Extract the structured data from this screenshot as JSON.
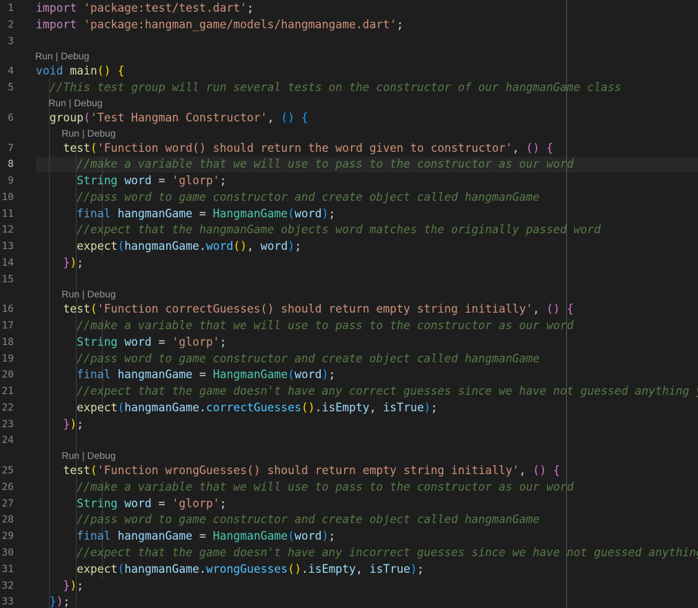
{
  "code_lens": {
    "run": "Run",
    "separator": " | ",
    "debug": "Debug"
  },
  "lines": [
    {
      "n": "1",
      "tokens": [
        [
          "import",
          "ctl"
        ],
        [
          " ",
          "pl"
        ],
        [
          "'package:test/test.dart'",
          "str"
        ],
        [
          ";",
          "pl"
        ]
      ]
    },
    {
      "n": "2",
      "tokens": [
        [
          "import",
          "ctl"
        ],
        [
          " ",
          "pl"
        ],
        [
          "'package:hangman_game/models/hangmangame.dart'",
          "str"
        ],
        [
          ";",
          "pl"
        ]
      ]
    },
    {
      "n": "3",
      "tokens": []
    },
    {
      "n": "4",
      "lens": true,
      "tokens": [
        [
          "void",
          "kw"
        ],
        [
          " ",
          "pl"
        ],
        [
          "main",
          "fn"
        ],
        [
          "()",
          "b1"
        ],
        [
          " ",
          "pl"
        ],
        [
          "{",
          "b1"
        ]
      ]
    },
    {
      "n": "5",
      "tokens": [
        [
          "  ",
          "pl"
        ],
        [
          "//This test group will run several tests on the constructor of our hangmanGame class",
          "cm"
        ]
      ]
    },
    {
      "n": "6",
      "lens": true,
      "tokens": [
        [
          "  ",
          "pl"
        ],
        [
          "group",
          "fn"
        ],
        [
          "(",
          "b2"
        ],
        [
          "'Test Hangman Constructor'",
          "str"
        ],
        [
          ", ",
          "pl"
        ],
        [
          "()",
          "b3"
        ],
        [
          " ",
          "pl"
        ],
        [
          "{",
          "b3"
        ]
      ]
    },
    {
      "n": "7",
      "lens": true,
      "tokens": [
        [
          "    ",
          "pl"
        ],
        [
          "test",
          "fn"
        ],
        [
          "(",
          "b1"
        ],
        [
          "'Function word() should return the word given to constructor'",
          "str"
        ],
        [
          ", ",
          "pl"
        ],
        [
          "()",
          "b2"
        ],
        [
          " ",
          "pl"
        ],
        [
          "{",
          "b2"
        ]
      ]
    },
    {
      "n": "8",
      "active": true,
      "tokens": [
        [
          "      ",
          "pl"
        ],
        [
          "//make a variable that we will use to pass to the constructor as our word",
          "cm"
        ]
      ]
    },
    {
      "n": "9",
      "tokens": [
        [
          "      ",
          "pl"
        ],
        [
          "String",
          "ty"
        ],
        [
          " ",
          "pl"
        ],
        [
          "word",
          "var"
        ],
        [
          " = ",
          "pl"
        ],
        [
          "'glorp'",
          "str"
        ],
        [
          ";",
          "pl"
        ]
      ]
    },
    {
      "n": "10",
      "tokens": [
        [
          "      ",
          "pl"
        ],
        [
          "//pass word to game constructor and create object called hangmanGame",
          "cm"
        ]
      ]
    },
    {
      "n": "11",
      "tokens": [
        [
          "      ",
          "pl"
        ],
        [
          "final",
          "kw"
        ],
        [
          " ",
          "pl"
        ],
        [
          "hangmanGame",
          "var"
        ],
        [
          " = ",
          "pl"
        ],
        [
          "HangmanGame",
          "ty"
        ],
        [
          "(",
          "b3"
        ],
        [
          "word",
          "var"
        ],
        [
          ")",
          "b3"
        ],
        [
          ";",
          "pl"
        ]
      ]
    },
    {
      "n": "12",
      "tokens": [
        [
          "      ",
          "pl"
        ],
        [
          "//expect that the hangmanGame objects word matches the originally passed word",
          "cm"
        ]
      ]
    },
    {
      "n": "13",
      "tokens": [
        [
          "      ",
          "pl"
        ],
        [
          "expect",
          "fn"
        ],
        [
          "(",
          "b3"
        ],
        [
          "hangmanGame",
          "var"
        ],
        [
          ".",
          "pl"
        ],
        [
          "word",
          "meth"
        ],
        [
          "()",
          "b1"
        ],
        [
          ", ",
          "pl"
        ],
        [
          "word",
          "var"
        ],
        [
          ")",
          "b3"
        ],
        [
          ";",
          "pl"
        ]
      ]
    },
    {
      "n": "14",
      "tokens": [
        [
          "    ",
          "pl"
        ],
        [
          "}",
          "b2"
        ],
        [
          ")",
          "b1"
        ],
        [
          ";",
          "pl"
        ]
      ]
    },
    {
      "n": "15",
      "tokens": []
    },
    {
      "n": "16",
      "lens": true,
      "tokens": [
        [
          "    ",
          "pl"
        ],
        [
          "test",
          "fn"
        ],
        [
          "(",
          "b1"
        ],
        [
          "'Function correctGuesses() should return empty string initially'",
          "str"
        ],
        [
          ", ",
          "pl"
        ],
        [
          "()",
          "b2"
        ],
        [
          " ",
          "pl"
        ],
        [
          "{",
          "b2"
        ]
      ]
    },
    {
      "n": "17",
      "tokens": [
        [
          "      ",
          "pl"
        ],
        [
          "//make a variable that we will use to pass to the constructor as our word",
          "cm"
        ]
      ]
    },
    {
      "n": "18",
      "tokens": [
        [
          "      ",
          "pl"
        ],
        [
          "String",
          "ty"
        ],
        [
          " ",
          "pl"
        ],
        [
          "word",
          "var"
        ],
        [
          " = ",
          "pl"
        ],
        [
          "'glorp'",
          "str"
        ],
        [
          ";",
          "pl"
        ]
      ]
    },
    {
      "n": "19",
      "tokens": [
        [
          "      ",
          "pl"
        ],
        [
          "//pass word to game constructor and create object called hangmanGame",
          "cm"
        ]
      ]
    },
    {
      "n": "20",
      "tokens": [
        [
          "      ",
          "pl"
        ],
        [
          "final",
          "kw"
        ],
        [
          " ",
          "pl"
        ],
        [
          "hangmanGame",
          "var"
        ],
        [
          " = ",
          "pl"
        ],
        [
          "HangmanGame",
          "ty"
        ],
        [
          "(",
          "b3"
        ],
        [
          "word",
          "var"
        ],
        [
          ")",
          "b3"
        ],
        [
          ";",
          "pl"
        ]
      ]
    },
    {
      "n": "21",
      "tokens": [
        [
          "      ",
          "pl"
        ],
        [
          "//expect that the game doesn't have any correct guesses since we have not guessed anything yet",
          "cm"
        ]
      ]
    },
    {
      "n": "22",
      "tokens": [
        [
          "      ",
          "pl"
        ],
        [
          "expect",
          "fn"
        ],
        [
          "(",
          "b3"
        ],
        [
          "hangmanGame",
          "var"
        ],
        [
          ".",
          "pl"
        ],
        [
          "correctGuesses",
          "meth"
        ],
        [
          "()",
          "b1"
        ],
        [
          ".",
          "pl"
        ],
        [
          "isEmpty",
          "var"
        ],
        [
          ", ",
          "pl"
        ],
        [
          "isTrue",
          "var"
        ],
        [
          ")",
          "b3"
        ],
        [
          ";",
          "pl"
        ]
      ]
    },
    {
      "n": "23",
      "tokens": [
        [
          "    ",
          "pl"
        ],
        [
          "}",
          "b2"
        ],
        [
          ")",
          "b1"
        ],
        [
          ";",
          "pl"
        ]
      ]
    },
    {
      "n": "24",
      "tokens": []
    },
    {
      "n": "25",
      "lens": true,
      "tokens": [
        [
          "    ",
          "pl"
        ],
        [
          "test",
          "fn"
        ],
        [
          "(",
          "b1"
        ],
        [
          "'Function wrongGuesses() should return empty string initially'",
          "str"
        ],
        [
          ", ",
          "pl"
        ],
        [
          "()",
          "b2"
        ],
        [
          " ",
          "pl"
        ],
        [
          "{",
          "b2"
        ]
      ]
    },
    {
      "n": "26",
      "tokens": [
        [
          "      ",
          "pl"
        ],
        [
          "//make a variable that we will use to pass to the constructor as our word",
          "cm"
        ]
      ]
    },
    {
      "n": "27",
      "tokens": [
        [
          "      ",
          "pl"
        ],
        [
          "String",
          "ty"
        ],
        [
          " ",
          "pl"
        ],
        [
          "word",
          "var"
        ],
        [
          " = ",
          "pl"
        ],
        [
          "'glorp'",
          "str"
        ],
        [
          ";",
          "pl"
        ]
      ]
    },
    {
      "n": "28",
      "tokens": [
        [
          "      ",
          "pl"
        ],
        [
          "//pass word to game constructor and create object called hangmanGame",
          "cm"
        ]
      ]
    },
    {
      "n": "29",
      "tokens": [
        [
          "      ",
          "pl"
        ],
        [
          "final",
          "kw"
        ],
        [
          " ",
          "pl"
        ],
        [
          "hangmanGame",
          "var"
        ],
        [
          " = ",
          "pl"
        ],
        [
          "HangmanGame",
          "ty"
        ],
        [
          "(",
          "b3"
        ],
        [
          "word",
          "var"
        ],
        [
          ")",
          "b3"
        ],
        [
          ";",
          "pl"
        ]
      ]
    },
    {
      "n": "30",
      "tokens": [
        [
          "      ",
          "pl"
        ],
        [
          "//expect that the game doesn't have any incorrect guesses since we have not guessed anything yet",
          "cm"
        ]
      ]
    },
    {
      "n": "31",
      "tokens": [
        [
          "      ",
          "pl"
        ],
        [
          "expect",
          "fn"
        ],
        [
          "(",
          "b3"
        ],
        [
          "hangmanGame",
          "var"
        ],
        [
          ".",
          "pl"
        ],
        [
          "wrongGuesses",
          "meth"
        ],
        [
          "()",
          "b1"
        ],
        [
          ".",
          "pl"
        ],
        [
          "isEmpty",
          "var"
        ],
        [
          ", ",
          "pl"
        ],
        [
          "isTrue",
          "var"
        ],
        [
          ")",
          "b3"
        ],
        [
          ";",
          "pl"
        ]
      ]
    },
    {
      "n": "32",
      "tokens": [
        [
          "    ",
          "pl"
        ],
        [
          "}",
          "b2"
        ],
        [
          ")",
          "b1"
        ],
        [
          ";",
          "pl"
        ]
      ]
    },
    {
      "n": "33",
      "tokens": [
        [
          "  ",
          "pl"
        ],
        [
          "}",
          "b3"
        ],
        [
          ")",
          "b2"
        ],
        [
          ";",
          "pl"
        ]
      ]
    }
  ]
}
